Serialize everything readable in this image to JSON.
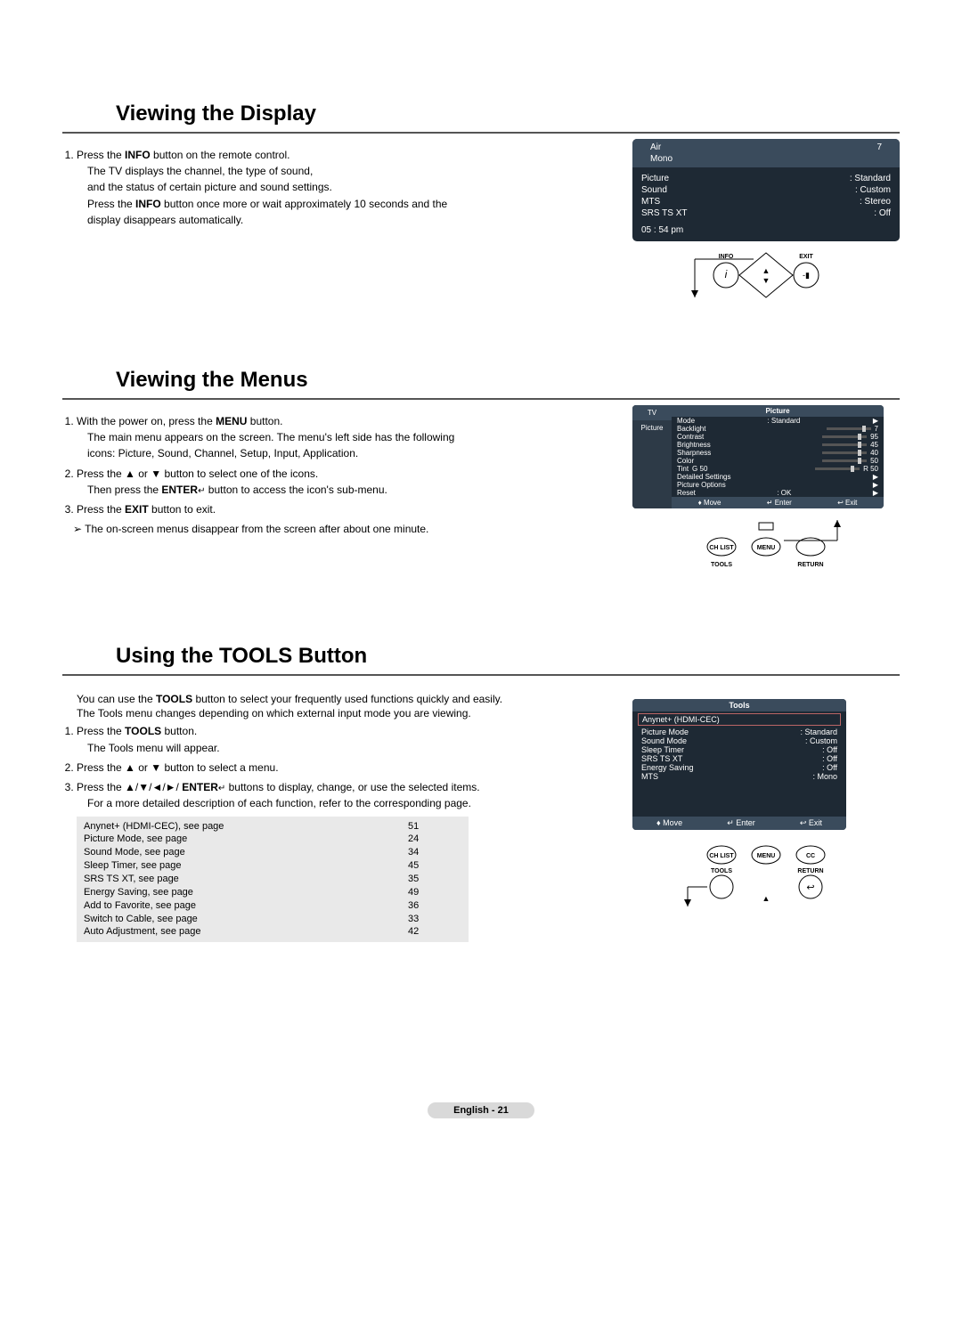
{
  "sections": {
    "display": {
      "title": "Viewing the Display",
      "step1_pre": "Press the ",
      "step1_btn": "INFO",
      "step1_post": " button on the remote control.",
      "step1_sub1": "The TV displays the channel, the type of sound,",
      "step1_sub2": "and the status of certain picture and sound settings.",
      "step1_sub3_pre": "Press the ",
      "step1_sub3_btn": "INFO",
      "step1_sub3_post": " button once more or wait approximately 10 seconds and the",
      "step1_sub4": "display disappears automatically."
    },
    "menus": {
      "title": "Viewing the Menus",
      "step1_pre": "With the power on, press the ",
      "step1_btn": "MENU",
      "step1_post": " button.",
      "step1_sub1": "The main menu appears on the screen. The menu's left side has the following",
      "step1_sub2": "icons: Picture, Sound, Channel, Setup, Input, Application.",
      "step2": "Press the ▲ or ▼ button to select one of the icons.",
      "step2_sub_pre": "Then press the ",
      "step2_sub_btn": "ENTER",
      "step2_sub_post": " button to access the icon's sub-menu.",
      "step3_pre": "Press the ",
      "step3_btn": "EXIT",
      "step3_post": " button to exit.",
      "note": "The on-screen menus disappear from the screen after about one minute."
    },
    "tools": {
      "title": "Using the TOOLS Button",
      "intro_pre": "You can use the ",
      "intro_btn": "TOOLS",
      "intro_post": " button to select your frequently used functions quickly and easily.",
      "intro_line2": "The Tools menu changes depending on which external input mode you are viewing.",
      "step1_pre": "Press the ",
      "step1_btn": "TOOLS",
      "step1_post": " button.",
      "step1_sub": "The Tools menu will appear.",
      "step2": "Press the ▲ or ▼ button to select a menu.",
      "step3_pre": "Press the ▲/▼/◄/►/",
      "step3_btn": "ENTER",
      "step3_post": " buttons to display, change, or use the selected items.",
      "step3_sub": "For a more detailed description of each function, refer to the corresponding page.",
      "pages": [
        {
          "label": "Anynet+ (HDMI-CEC), see page",
          "page": "51"
        },
        {
          "label": "Picture Mode, see page",
          "page": "24"
        },
        {
          "label": "Sound Mode, see page",
          "page": "34"
        },
        {
          "label": "Sleep Timer, see page",
          "page": "45"
        },
        {
          "label": "SRS TS XT, see page",
          "page": "35"
        },
        {
          "label": "Energy Saving, see page",
          "page": "49"
        },
        {
          "label": "Add to Favorite, see page",
          "page": "36"
        },
        {
          "label": "Switch to Cable, see page",
          "page": "33"
        },
        {
          "label": "Auto Adjustment, see page",
          "page": "42"
        }
      ]
    }
  },
  "osd_info": {
    "air_label": "Air",
    "air_ch": "7",
    "mono": "Mono",
    "rows": [
      {
        "l": "Picture",
        "r": ": Standard"
      },
      {
        "l": "Sound",
        "r": ": Custom"
      },
      {
        "l": "MTS",
        "r": ": Stereo"
      },
      {
        "l": "SRS TS XT",
        "r": ": Off"
      }
    ],
    "time": "05 : 54 pm"
  },
  "osd_menu": {
    "tvtab": "TV",
    "pictab": "Picture",
    "header": "Picture",
    "lines": [
      {
        "l": "Mode",
        "r": ": Standard",
        "arrow": "▶"
      },
      {
        "l": "Backlight",
        "slider": true,
        "r": "7"
      },
      {
        "l": "Contrast",
        "slider": true,
        "r": "95"
      },
      {
        "l": "Brightness",
        "slider": true,
        "r": "45"
      },
      {
        "l": "Sharpness",
        "slider": true,
        "r": "40"
      },
      {
        "l": "Color",
        "slider": true,
        "r": "50"
      },
      {
        "l": "Tint",
        "mid": "G 50",
        "slider": true,
        "r": "R 50"
      },
      {
        "l": "Detailed Settings",
        "r": "",
        "arrow": "▶"
      },
      {
        "l": "Picture Options",
        "r": "",
        "arrow": "▶"
      },
      {
        "l": "Reset",
        "r": ": OK",
        "arrow": "▶"
      }
    ],
    "ftr": {
      "move": "Move",
      "enter": "Enter",
      "exit": "Exit"
    }
  },
  "osd_tools": {
    "title": "Tools",
    "sel": "Anynet+ (HDMI-CEC)",
    "rows": [
      {
        "l": "Picture Mode",
        "r": ": Standard"
      },
      {
        "l": "Sound Mode",
        "r": ": Custom"
      },
      {
        "l": "Sleep Timer",
        "r": ": Off"
      },
      {
        "l": "SRS TS XT",
        "r": ": Off"
      },
      {
        "l": "Energy Saving",
        "r": ": Off"
      },
      {
        "l": "MTS",
        "r": ": Mono"
      }
    ],
    "ftr": {
      "move": "Move",
      "enter": "Enter",
      "exit": "Exit"
    }
  },
  "remote": {
    "info": "INFO",
    "exit": "EXIT",
    "chlist": "CH LIST",
    "menu": "MENU",
    "cc": "CC",
    "tools": "TOOLS",
    "return": "RETURN"
  },
  "footer": "English - 21"
}
